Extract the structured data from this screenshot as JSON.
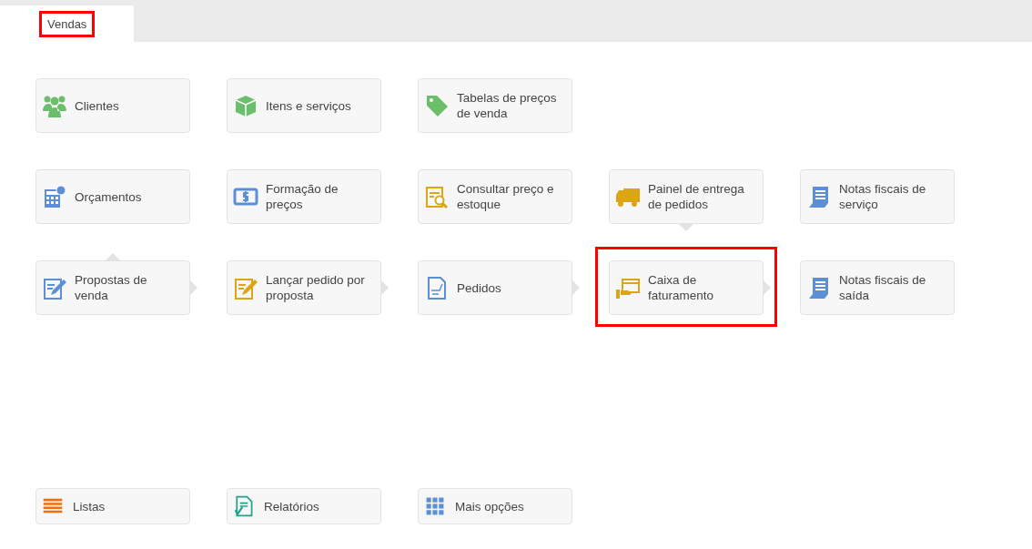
{
  "tabs": [
    {
      "label": "Vendas",
      "selected": true,
      "highlighted": true
    }
  ],
  "tile_rows": [
    [
      {
        "label": "Clientes",
        "kind": "people"
      },
      {
        "label": "Itens e serviços",
        "kind": "box"
      },
      {
        "label": "Tabelas de preços de venda",
        "kind": "tag"
      }
    ],
    [
      {
        "label": "Orçamentos",
        "kind": "calculator"
      },
      {
        "label": "Formação de preços",
        "kind": "dollar"
      },
      {
        "label": "Consultar preço e estoque",
        "kind": "search"
      },
      {
        "label": "Painel de entrega de pedidos",
        "kind": "truck",
        "flow_down": true
      },
      {
        "label": "Notas fiscais de serviço",
        "kind": "receipt"
      }
    ],
    [
      {
        "label": "Propostas de venda",
        "kind": "proposal",
        "flow_next": true,
        "flow_from_above": true
      },
      {
        "label": "Lançar pedido por proposta",
        "kind": "order-entry",
        "flow_next": true
      },
      {
        "label": "Pedidos",
        "kind": "orders",
        "flow_next": true
      },
      {
        "label": "Caixa de faturamento",
        "kind": "cash",
        "flow_next": true,
        "highlighted": true
      },
      {
        "label": "Notas fiscais de saída",
        "kind": "receipt"
      }
    ]
  ],
  "bottom_tiles": [
    {
      "label": "Listas",
      "kind": "lines"
    },
    {
      "label": "Relatórios",
      "kind": "report"
    },
    {
      "label": "Mais opções",
      "kind": "grid"
    }
  ]
}
